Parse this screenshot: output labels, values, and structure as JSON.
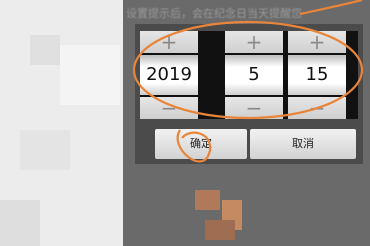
{
  "hint_text": "设置提示后，会在纪念日当天提醒您",
  "date_picker": {
    "increment_symbol": "+",
    "decrement_symbol": "−",
    "year": "2019",
    "month": "5",
    "day": "15"
  },
  "buttons": {
    "confirm": "确定",
    "cancel": "取消"
  },
  "annotation_color": "#e8853a"
}
